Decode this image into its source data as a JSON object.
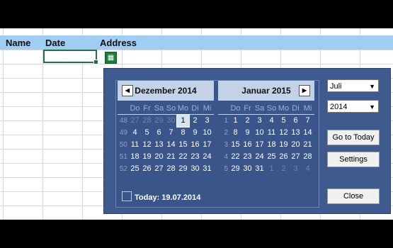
{
  "sheet": {
    "headers": [
      "Name",
      "Date",
      "Address"
    ],
    "calendar_button_icon": "calendar-icon"
  },
  "calendar": {
    "left_month": {
      "title": "Dezember 2014",
      "nav_icon": "chevron-left-icon",
      "weekdays": [
        "Do",
        "Fr",
        "Sa",
        "So",
        "Mo",
        "Di",
        "Mi"
      ],
      "weeks": [
        {
          "num": "48",
          "days": [
            [
              "27",
              1
            ],
            [
              "28",
              1
            ],
            [
              "29",
              1
            ],
            [
              "30",
              1
            ],
            [
              "1",
              2
            ],
            [
              "2",
              0
            ],
            [
              "3",
              0
            ]
          ]
        },
        {
          "num": "49",
          "days": [
            [
              "4",
              0
            ],
            [
              "5",
              0
            ],
            [
              "6",
              0
            ],
            [
              "7",
              0
            ],
            [
              "8",
              0
            ],
            [
              "9",
              0
            ],
            [
              "10",
              0
            ]
          ]
        },
        {
          "num": "50",
          "days": [
            [
              "11",
              0
            ],
            [
              "12",
              0
            ],
            [
              "13",
              0
            ],
            [
              "14",
              0
            ],
            [
              "15",
              0
            ],
            [
              "16",
              0
            ],
            [
              "17",
              0
            ]
          ]
        },
        {
          "num": "51",
          "days": [
            [
              "18",
              0
            ],
            [
              "19",
              0
            ],
            [
              "20",
              0
            ],
            [
              "21",
              0
            ],
            [
              "22",
              0
            ],
            [
              "23",
              0
            ],
            [
              "24",
              0
            ]
          ]
        },
        {
          "num": "52",
          "days": [
            [
              "25",
              0
            ],
            [
              "26",
              0
            ],
            [
              "27",
              0
            ],
            [
              "28",
              0
            ],
            [
              "29",
              0
            ],
            [
              "30",
              0
            ],
            [
              "31",
              0
            ]
          ]
        }
      ]
    },
    "right_month": {
      "title": "Januar 2015",
      "nav_icon": "chevron-right-icon",
      "weekdays": [
        "Do",
        "Fr",
        "Sa",
        "So",
        "Mo",
        "Di",
        "Mi"
      ],
      "weeks": [
        {
          "num": "1",
          "days": [
            [
              "1",
              0
            ],
            [
              "2",
              0
            ],
            [
              "3",
              0
            ],
            [
              "4",
              0
            ],
            [
              "5",
              0
            ],
            [
              "6",
              0
            ],
            [
              "7",
              0
            ]
          ]
        },
        {
          "num": "2",
          "days": [
            [
              "8",
              0
            ],
            [
              "9",
              0
            ],
            [
              "10",
              0
            ],
            [
              "11",
              0
            ],
            [
              "12",
              0
            ],
            [
              "13",
              0
            ],
            [
              "14",
              0
            ]
          ]
        },
        {
          "num": "3",
          "days": [
            [
              "15",
              0
            ],
            [
              "16",
              0
            ],
            [
              "17",
              0
            ],
            [
              "18",
              0
            ],
            [
              "19",
              0
            ],
            [
              "20",
              0
            ],
            [
              "21",
              0
            ]
          ]
        },
        {
          "num": "4",
          "days": [
            [
              "22",
              0
            ],
            [
              "23",
              0
            ],
            [
              "24",
              0
            ],
            [
              "25",
              0
            ],
            [
              "26",
              0
            ],
            [
              "27",
              0
            ],
            [
              "28",
              0
            ]
          ]
        },
        {
          "num": "5",
          "days": [
            [
              "29",
              0
            ],
            [
              "30",
              0
            ],
            [
              "31",
              0
            ],
            [
              "1",
              1
            ],
            [
              "2",
              1
            ],
            [
              "3",
              1
            ],
            [
              "4",
              1
            ]
          ]
        }
      ]
    },
    "today_label": "Today: 19.07.2014"
  },
  "controls": {
    "month_select": "Juli",
    "year_select": "2014",
    "goto_today": "Go to Today",
    "settings": "Settings",
    "close": "Close"
  },
  "colors": {
    "panel": "#3f5a8f",
    "header_row": "#9fcdf3",
    "selection": "#217346"
  }
}
